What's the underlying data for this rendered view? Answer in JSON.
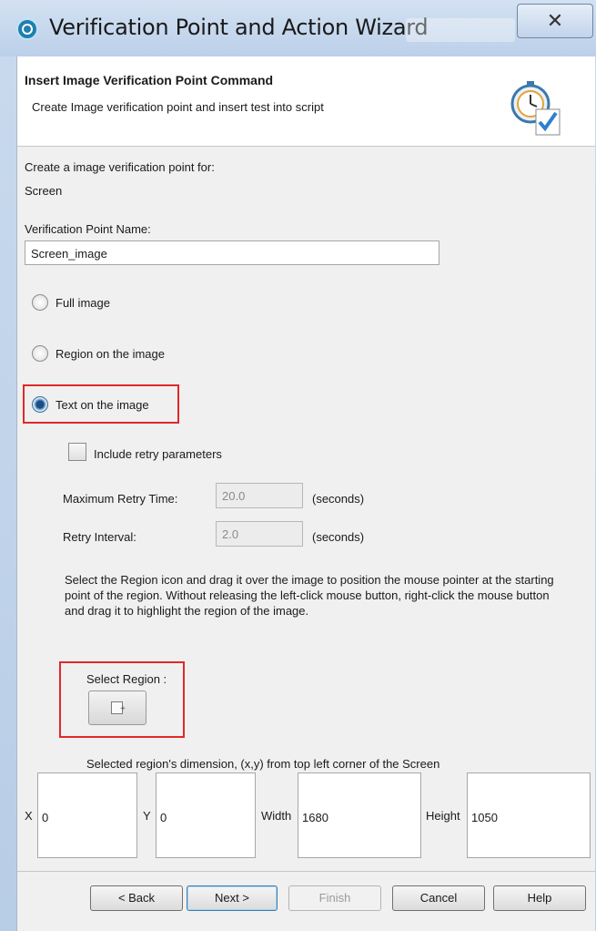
{
  "window": {
    "title": "Verification Point and Action Wizard",
    "close_glyph": "✕"
  },
  "header": {
    "title": "Insert Image Verification Point Command",
    "subtitle": "Create Image verification point and insert test into script",
    "icon": "stopwatch-check-icon"
  },
  "form": {
    "create_for_label": "Create a image verification point for:",
    "create_for_value": "Screen",
    "vp_name_label": "Verification Point Name:",
    "vp_name_value": "Screen_image",
    "options": [
      {
        "label": "Full image",
        "selected": false
      },
      {
        "label": "Region on the image",
        "selected": false
      },
      {
        "label": "Text on the image",
        "selected": true
      }
    ],
    "retry_checkbox_label": "Include retry parameters",
    "retry_checked": false,
    "max_retry_label": "Maximum Retry Time:",
    "max_retry_value": "20.0",
    "retry_interval_label": "Retry Interval:",
    "retry_interval_value": "2.0",
    "seconds_label": "(seconds)",
    "instructions": "Select the Region icon and drag it over the image to position the mouse pointer at the starting point of the region. Without  releasing the left-click mouse button, right-click the mouse  button and drag it to highlight the region of the image.",
    "select_region_label": "Select Region :",
    "dimension_caption": "Selected region's dimension, (x,y) from top left corner of the Screen",
    "dims": {
      "x_label": "X",
      "x_value": "0",
      "y_label": "Y",
      "y_value": "0",
      "width_label": "Width",
      "width_value": "1680",
      "height_label": "Height",
      "height_value": "1050"
    }
  },
  "buttons": {
    "back": "< Back",
    "next": "Next >",
    "finish": "Finish",
    "cancel": "Cancel",
    "help": "Help"
  },
  "colors": {
    "highlight": "#e02929",
    "title_bar": "#bcd0ea"
  }
}
